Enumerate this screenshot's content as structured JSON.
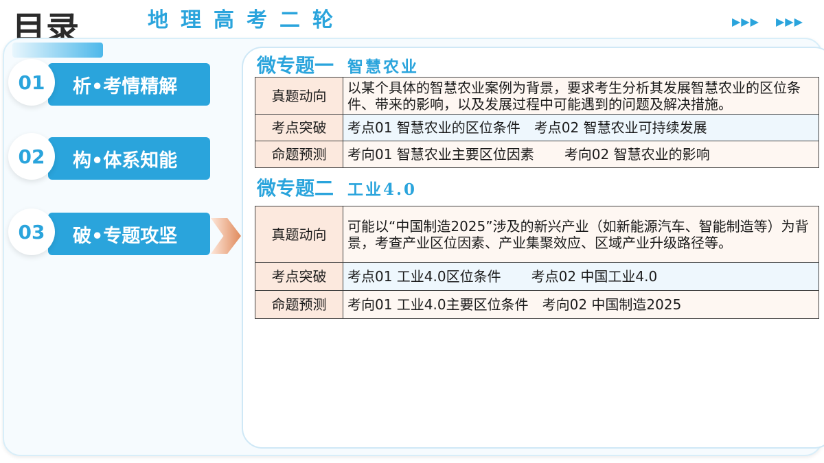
{
  "header": {
    "page_title": "目录",
    "course_title": "地理高考二轮",
    "arrows_left": "▶▶▶",
    "arrows_right": "▶▶▶"
  },
  "nav": {
    "items": [
      {
        "num": "01",
        "label": "析•考情精解"
      },
      {
        "num": "02",
        "label": "构•体系知能"
      },
      {
        "num": "03",
        "label": "破•专题攻坚"
      }
    ],
    "active_index": 2
  },
  "topics": [
    {
      "label": "微专题一",
      "name": "智慧农业",
      "rows": [
        {
          "head": "真题动向",
          "content": "以某个具体的智慧农业案例为背景，要求考生分析其发展智慧农业的区位条件、带来的影响，以及发展过程中可能遇到的问题及解决措施。"
        },
        {
          "head": "考点突破",
          "item1": "考点01 智慧农业的区位条件",
          "item2": "考点02 智慧农业可持续发展"
        },
        {
          "head": "命题预测",
          "item1": "考向01 智慧农业主要区位因素",
          "item2": "考向02 智慧农业的影响"
        }
      ]
    },
    {
      "label": "微专题二",
      "name": "工业4.0",
      "rows": [
        {
          "head": "真题动向",
          "content": "可能以“中国制造2025”涉及的新兴产业（如新能源汽车、智能制造等）为背景，考查产业区位因素、产业集聚效应、区域产业升级路径等。"
        },
        {
          "head": "考点突破",
          "item1": "考点01 工业4.0区位条件",
          "item2": "考点02  中国工业4.0"
        },
        {
          "head": "命题预测",
          "item1": "考向01 工业4.0主要区位条件",
          "item2": "考向02 中国制造2025"
        }
      ]
    }
  ],
  "colors": {
    "accent": "#2aa4dc",
    "label_cell_bg": "#fce9de",
    "arrow": "#e08a5c"
  }
}
